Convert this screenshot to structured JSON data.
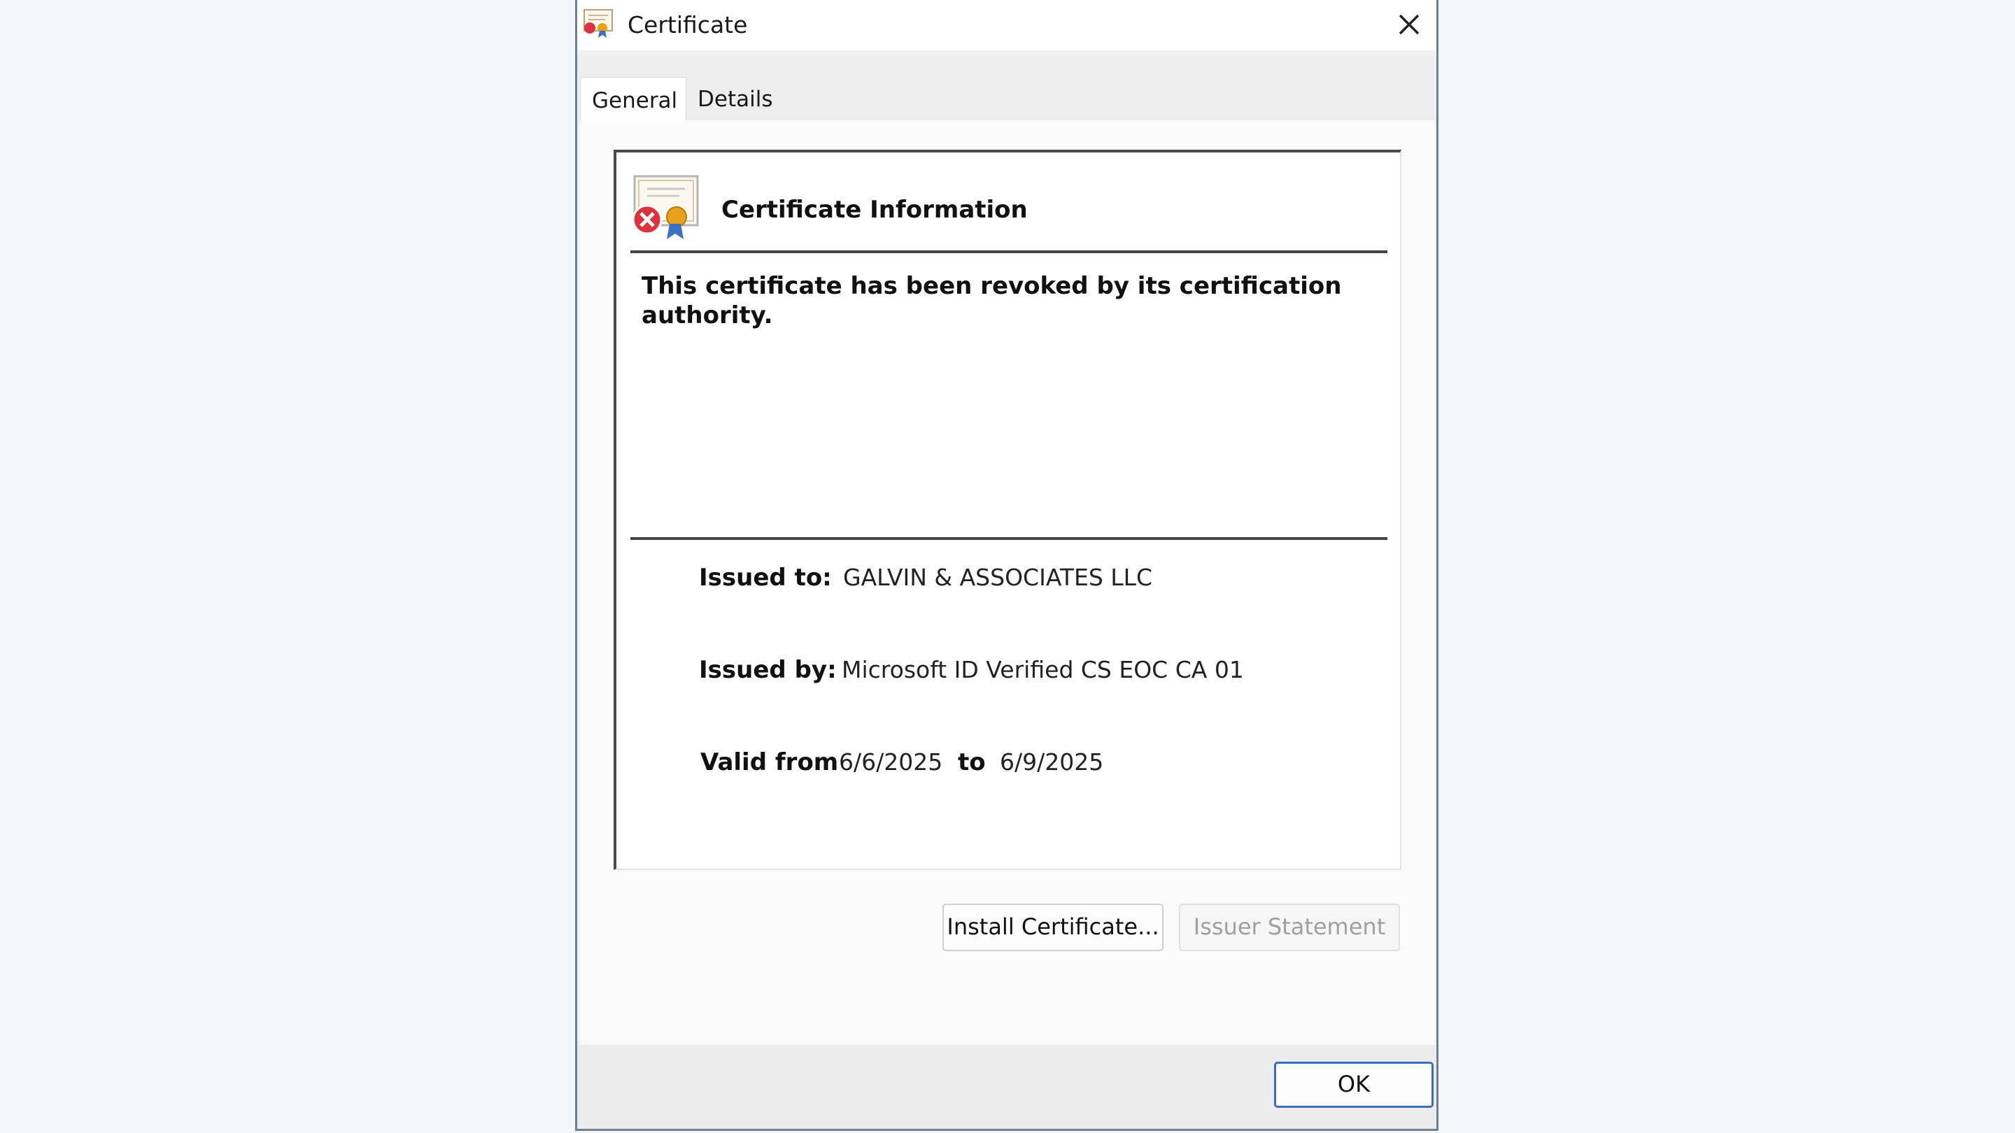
{
  "window": {
    "title": "Certificate",
    "close_icon": "close-icon",
    "title_icon": "certificate-icon"
  },
  "tabs": [
    {
      "label": "General",
      "selected": true
    },
    {
      "label": "Details",
      "selected": false
    }
  ],
  "info": {
    "heading": "Certificate Information",
    "icon": "revoked-certificate-icon",
    "status": "This certificate has been revoked by its certification authority."
  },
  "fields": {
    "issued_to_label": "Issued to:",
    "issued_to_value": "GALVIN & ASSOCIATES LLC",
    "issued_by_label": "Issued by:",
    "issued_by_value": "Microsoft ID Verified CS EOC CA 01",
    "valid_from_label": "Valid from",
    "valid_from_value": "6/6/2025",
    "valid_to_label": "to",
    "valid_to_value": "6/9/2025"
  },
  "buttons": {
    "install": "Install Certificate...",
    "issuer_statement": "Issuer Statement",
    "ok": "OK"
  },
  "colors": {
    "revoked_badge": "#d9343e",
    "ribbon": "#e8a21a",
    "ok_border": "#3b6fb6"
  }
}
